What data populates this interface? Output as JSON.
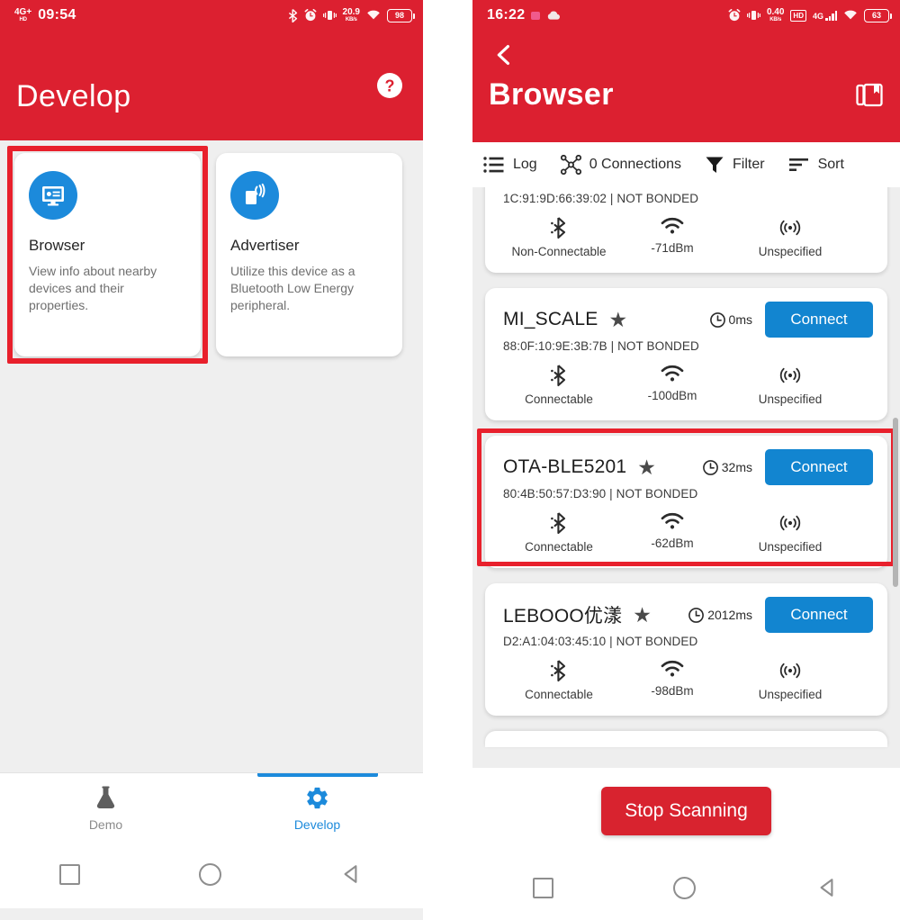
{
  "theme": {
    "red": "#DC2030",
    "red_button": "#D8232F",
    "blue": "#1285D0",
    "icon_blue": "#1C8ADB",
    "highlight_red": "#E8202C",
    "page_bg": "#EEEEEE"
  },
  "left_screen": {
    "status_bar": {
      "network_label": "4G+",
      "network_sub": "HD",
      "time": "09:54",
      "icons": [
        "bluetooth-icon",
        "alarm-icon",
        "vibrate-icon",
        "wifi-icon"
      ],
      "data_rate_value": "20.9",
      "data_rate_unit": "KB/s",
      "battery": "98"
    },
    "appbar": {
      "title": "Develop",
      "help_icon": "help-circle-icon"
    },
    "cards": [
      {
        "icon": "browser-monitor-icon",
        "title": "Browser",
        "description": "View info about nearby devices and their properties.",
        "highlighted": true
      },
      {
        "icon": "advertiser-broadcast-icon",
        "title": "Advertiser",
        "description": "Utilize this device as a Bluetooth Low Energy peripheral.",
        "highlighted": false
      }
    ],
    "tabs": [
      {
        "label": "Demo",
        "icon": "flask-icon",
        "active": false
      },
      {
        "label": "Develop",
        "icon": "gear-icon",
        "active": true
      }
    ],
    "nav_bar": [
      "recents-square-icon",
      "home-circle-icon",
      "back-triangle-icon"
    ]
  },
  "right_screen": {
    "status_bar": {
      "time": "16:22",
      "left_icons": [
        "pink-chip-icon",
        "cloud-icon"
      ],
      "icons": [
        "alarm-icon",
        "vibrate-icon",
        "wifi-icon"
      ],
      "data_rate_value": "0.40",
      "data_rate_unit": "KB/s",
      "hd_label": "HD",
      "network_label": "4G",
      "battery": "63"
    },
    "appbar": {
      "back_icon": "back-chevron-icon",
      "title": "Browser",
      "action_icon": "bookmark-copy-icon"
    },
    "toolbar": [
      {
        "icon": "list-log-icon",
        "label": "Log"
      },
      {
        "icon": "connections-node-icon",
        "label": "0 Connections"
      },
      {
        "icon": "filter-funnel-icon",
        "label": "Filter"
      },
      {
        "icon": "sort-lines-icon",
        "label": "Sort"
      }
    ],
    "devices": [
      {
        "name": "",
        "mac": "1C:91:9D:66:39:02 | NOT BONDED",
        "connectivity": "Non-Connectable",
        "rssi": "-71dBm",
        "appearance": "Unspecified",
        "latency": "",
        "connect_label": "",
        "favorited": false,
        "clipped": true,
        "highlighted": false
      },
      {
        "name": "MI_SCALE",
        "mac": "88:0F:10:9E:3B:7B | NOT BONDED",
        "connectivity": "Connectable",
        "rssi": "-100dBm",
        "appearance": "Unspecified",
        "latency": "0ms",
        "connect_label": "Connect",
        "favorited": true,
        "clipped": false,
        "highlighted": false
      },
      {
        "name": "OTA-BLE5201",
        "mac": "80:4B:50:57:D3:90 | NOT BONDED",
        "connectivity": "Connectable",
        "rssi": "-62dBm",
        "appearance": "Unspecified",
        "latency": "32ms",
        "connect_label": "Connect",
        "favorited": true,
        "clipped": false,
        "highlighted": true
      },
      {
        "name": "LEBOOO优漾",
        "mac": "D2:A1:04:03:45:10 | NOT BONDED",
        "connectivity": "Connectable",
        "rssi": "-98dBm",
        "appearance": "Unspecified",
        "latency": "2012ms",
        "connect_label": "Connect",
        "favorited": true,
        "clipped": false,
        "highlighted": false
      }
    ],
    "stop_button": "Stop Scanning",
    "nav_bar": [
      "recents-square-icon",
      "home-circle-icon",
      "back-triangle-icon"
    ]
  }
}
